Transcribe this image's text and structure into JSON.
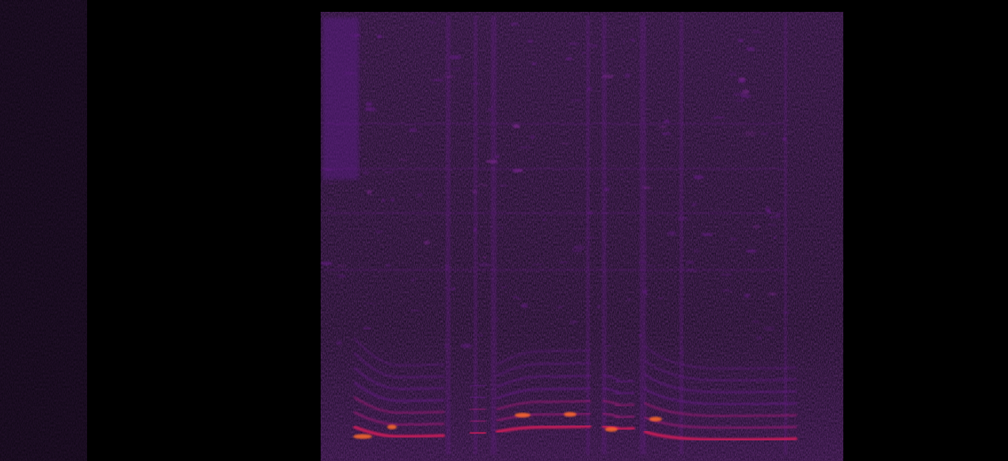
{
  "image": {
    "kind": "spectrogram",
    "colormap": "magma",
    "background_color": "#000000",
    "low_energy_color": "#1a0b2e",
    "mid_energy_color": "#6a1a8c",
    "high_energy_color": "#c81b5a",
    "peak_energy_color": "#ff6a2a",
    "grid": false,
    "axes_visible": false,
    "text_visible": false
  }
}
